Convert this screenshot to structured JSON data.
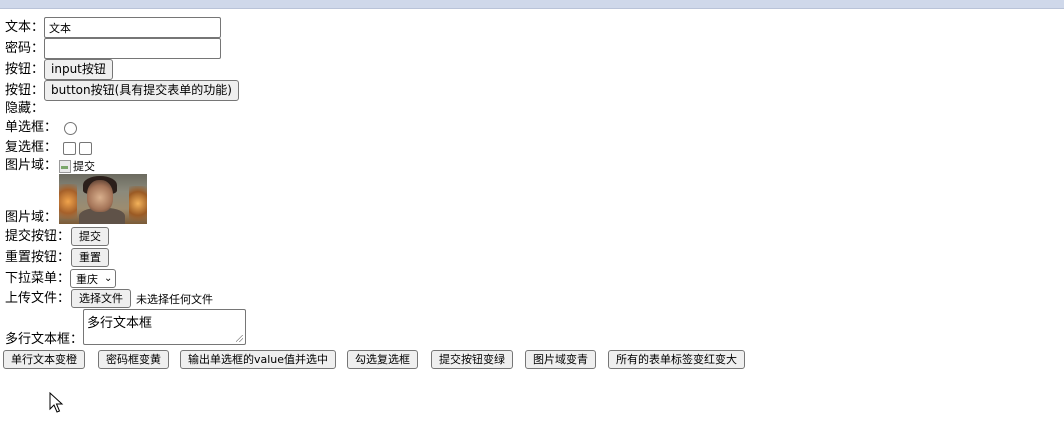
{
  "form": {
    "text_label": "文本：",
    "text_value": "文本",
    "password_label": "密码：",
    "password_value": "",
    "input_button_label": "按钮：",
    "input_button_text": "input按钮",
    "button_label": "按钮：",
    "button_text": "button按钮(具有提交表单的功能)",
    "hidden_label": "隐藏：",
    "radio_label": "单选框：",
    "checkbox_label": "复选框：",
    "imagefield_label_1": "图片域：",
    "image_alt": "提交",
    "imagefield_label_2": "图片域：",
    "submit_label": "提交按钮：",
    "submit_text": "提交",
    "reset_label": "重置按钮：",
    "reset_text": "重置",
    "select_label": "下拉菜单：",
    "select_value": "重庆",
    "file_label": "上传文件：",
    "file_button_text": "选择文件",
    "file_status": "未选择任何文件",
    "textarea_label": "多行文本框：",
    "textarea_value": "多行文本框"
  },
  "actions": [
    "单行文本变橙",
    "密码框变黄",
    "输出单选框的value值并选中",
    "勾选复选框",
    "提交按钮变绿",
    "图片域变青",
    "所有的表单标签变红变大"
  ],
  "icons": {
    "cursor": "mouse-pointer-icon",
    "broken_image": "broken-image-icon",
    "select_caret": "chevron-down-icon"
  }
}
